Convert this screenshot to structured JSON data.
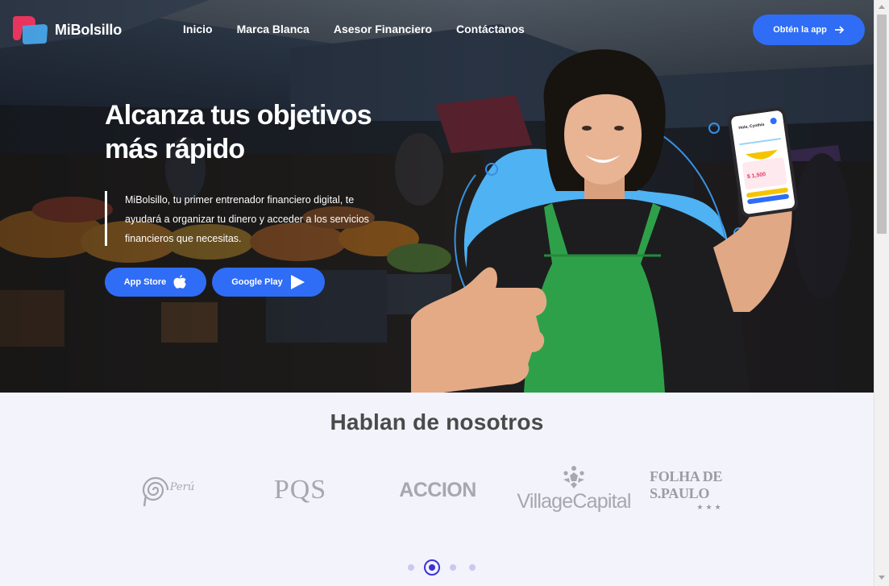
{
  "brand": {
    "name": "MiBolsillo"
  },
  "nav": {
    "links": [
      "Inicio",
      "Marca Blanca",
      "Asesor Financiero",
      "Contáctanos"
    ],
    "cta": "Obtén la app"
  },
  "hero": {
    "title_line1": "Alcanza tus objetivos",
    "title_line2": "más rápido",
    "description": "MiBolsillo, tu primer entrenador financiero digital, te ayudará a organizar tu dinero y acceder a los servicios financieros que necesitas.",
    "app_store": "App Store",
    "google_play": "Google Play"
  },
  "phone": {
    "greeting": "Hola, Cynthia",
    "amount": "$ 1,500"
  },
  "press": {
    "title": "Hablan de nosotros",
    "logos": [
      "Perú",
      "PQS",
      "ACCION",
      "VillageCapital",
      "FOLHA DE S.PAULO"
    ]
  },
  "carousel": {
    "count": 4,
    "active": 1
  },
  "colors": {
    "accent": "#2f6df6",
    "dot_active": "#3d32d6",
    "apron": "#2fa04a"
  }
}
